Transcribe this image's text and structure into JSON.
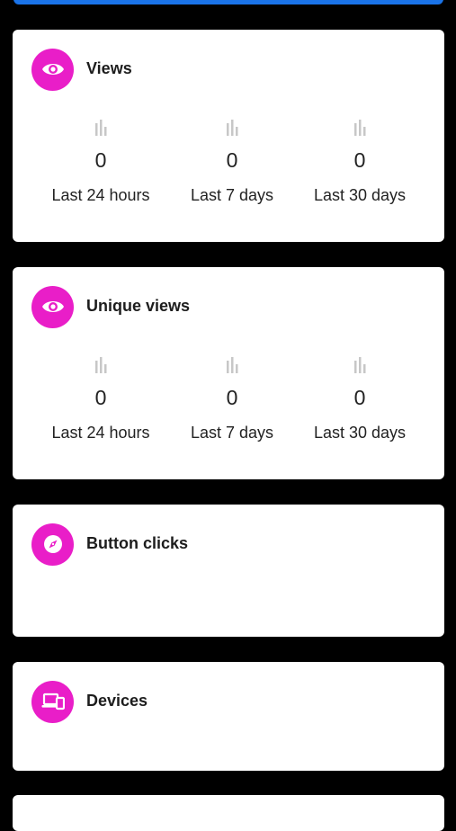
{
  "colors": {
    "accent": "#e91ec8",
    "top_bar": "#1a73e8",
    "background": "#000000",
    "card": "#ffffff",
    "muted_icon": "#c7c7c7"
  },
  "cards": [
    {
      "title": "Views",
      "icon": "eye-icon",
      "stats": [
        {
          "value": "0",
          "label": "Last 24 hours"
        },
        {
          "value": "0",
          "label": "Last 7 days"
        },
        {
          "value": "0",
          "label": "Last 30 days"
        }
      ]
    },
    {
      "title": "Unique views",
      "icon": "eye-icon",
      "stats": [
        {
          "value": "0",
          "label": "Last 24 hours"
        },
        {
          "value": "0",
          "label": "Last 7 days"
        },
        {
          "value": "0",
          "label": "Last 30 days"
        }
      ]
    },
    {
      "title": "Button clicks",
      "icon": "compass-icon"
    },
    {
      "title": "Devices",
      "icon": "devices-icon"
    }
  ]
}
